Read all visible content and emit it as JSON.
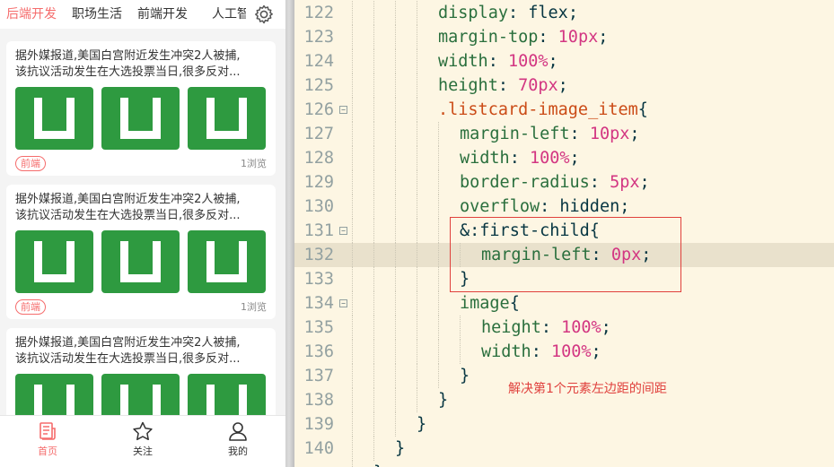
{
  "tabs": [
    "后端开发",
    "职场生活",
    "前端开发",
    "人工智能"
  ],
  "cards": [
    {
      "title_line1": "据外媒报道,美国白宫附近发生冲突2人被捕,",
      "title_line2": "该抗议活动发生在大选投票当日,很多反对...",
      "tag": "前端",
      "views": "1浏览"
    },
    {
      "title_line1": "据外媒报道,美国白宫附近发生冲突2人被捕,",
      "title_line2": "该抗议活动发生在大选投票当日,很多反对...",
      "tag": "前端",
      "views": "1浏览"
    },
    {
      "title_line1": "据外媒报道,美国白宫附近发生冲突2人被捕,",
      "title_line2": "该抗议活动发生在大选投票当日,很多反对...",
      "tag": "",
      "views": ""
    }
  ],
  "bottom_nav": [
    "首页",
    "关注",
    "我的"
  ],
  "code_lines": [
    {
      "num": "122",
      "indent": 4,
      "segments": [
        [
          "k",
          "display"
        ],
        [
          "p",
          ": "
        ],
        [
          "v",
          "flex"
        ],
        [
          "p",
          ";"
        ]
      ]
    },
    {
      "num": "123",
      "indent": 4,
      "segments": [
        [
          "k",
          "margin-top"
        ],
        [
          "p",
          ": "
        ],
        [
          "n",
          "10"
        ],
        [
          "u2",
          "px"
        ],
        [
          "p",
          ";"
        ]
      ]
    },
    {
      "num": "124",
      "indent": 4,
      "segments": [
        [
          "k",
          "width"
        ],
        [
          "p",
          ": "
        ],
        [
          "n",
          "100"
        ],
        [
          "u2",
          "%"
        ],
        [
          "p",
          ";"
        ]
      ]
    },
    {
      "num": "125",
      "indent": 4,
      "segments": [
        [
          "k",
          "height"
        ],
        [
          "p",
          ": "
        ],
        [
          "n",
          "70"
        ],
        [
          "u2",
          "px"
        ],
        [
          "p",
          ";"
        ]
      ]
    },
    {
      "num": "126",
      "indent": 4,
      "fold": "−",
      "segments": [
        [
          "sel",
          ".listcard-image_item"
        ],
        [
          "b",
          "{"
        ]
      ]
    },
    {
      "num": "127",
      "indent": 5,
      "segments": [
        [
          "k",
          "margin-left"
        ],
        [
          "p",
          ": "
        ],
        [
          "n",
          "10"
        ],
        [
          "u2",
          "px"
        ],
        [
          "p",
          ";"
        ]
      ]
    },
    {
      "num": "128",
      "indent": 5,
      "segments": [
        [
          "k",
          "width"
        ],
        [
          "p",
          ": "
        ],
        [
          "n",
          "100"
        ],
        [
          "u2",
          "%"
        ],
        [
          "p",
          ";"
        ]
      ]
    },
    {
      "num": "129",
      "indent": 5,
      "segments": [
        [
          "k",
          "border-radius"
        ],
        [
          "p",
          ": "
        ],
        [
          "n",
          "5"
        ],
        [
          "u2",
          "px"
        ],
        [
          "p",
          ";"
        ]
      ]
    },
    {
      "num": "130",
      "indent": 5,
      "segments": [
        [
          "k",
          "overflow"
        ],
        [
          "p",
          ": "
        ],
        [
          "v",
          "hidden"
        ],
        [
          "p",
          ";"
        ]
      ]
    },
    {
      "num": "131",
      "indent": 5,
      "fold": "−",
      "segments": [
        [
          "b",
          "&"
        ],
        [
          "p",
          ":first-child"
        ],
        [
          "b",
          "{"
        ]
      ]
    },
    {
      "num": "132",
      "indent": 6,
      "current": true,
      "segments": [
        [
          "k",
          "margin-left"
        ],
        [
          "p",
          ": "
        ],
        [
          "n",
          "0"
        ],
        [
          "u2",
          "px"
        ],
        [
          "p",
          ";"
        ]
      ]
    },
    {
      "num": "133",
      "indent": 5,
      "segments": [
        [
          "b",
          "}"
        ]
      ]
    },
    {
      "num": "134",
      "indent": 5,
      "fold": "−",
      "segments": [
        [
          "k",
          "image"
        ],
        [
          "b",
          "{"
        ]
      ]
    },
    {
      "num": "135",
      "indent": 6,
      "segments": [
        [
          "k",
          "height"
        ],
        [
          "p",
          ": "
        ],
        [
          "n",
          "100"
        ],
        [
          "u2",
          "%"
        ],
        [
          "p",
          ";"
        ]
      ]
    },
    {
      "num": "136",
      "indent": 6,
      "segments": [
        [
          "k",
          "width"
        ],
        [
          "p",
          ": "
        ],
        [
          "n",
          "100"
        ],
        [
          "u2",
          "%"
        ],
        [
          "p",
          ";"
        ]
      ]
    },
    {
      "num": "137",
      "indent": 5,
      "segments": [
        [
          "b",
          "}"
        ]
      ]
    },
    {
      "num": "138",
      "indent": 4,
      "segments": [
        [
          "b",
          "}"
        ]
      ]
    },
    {
      "num": "139",
      "indent": 3,
      "segments": [
        [
          "b",
          "}"
        ]
      ]
    },
    {
      "num": "140",
      "indent": 2,
      "segments": [
        [
          "b",
          "}"
        ]
      ]
    },
    {
      "num": "",
      "indent": 1,
      "segments": [
        [
          "b",
          "}"
        ]
      ]
    }
  ],
  "annotation": "解决第1个元素左边距的间距",
  "colors": {
    "accent": "#f56c6c",
    "thumb_green": "#2e9a40",
    "annotation_red": "#e0403c"
  }
}
